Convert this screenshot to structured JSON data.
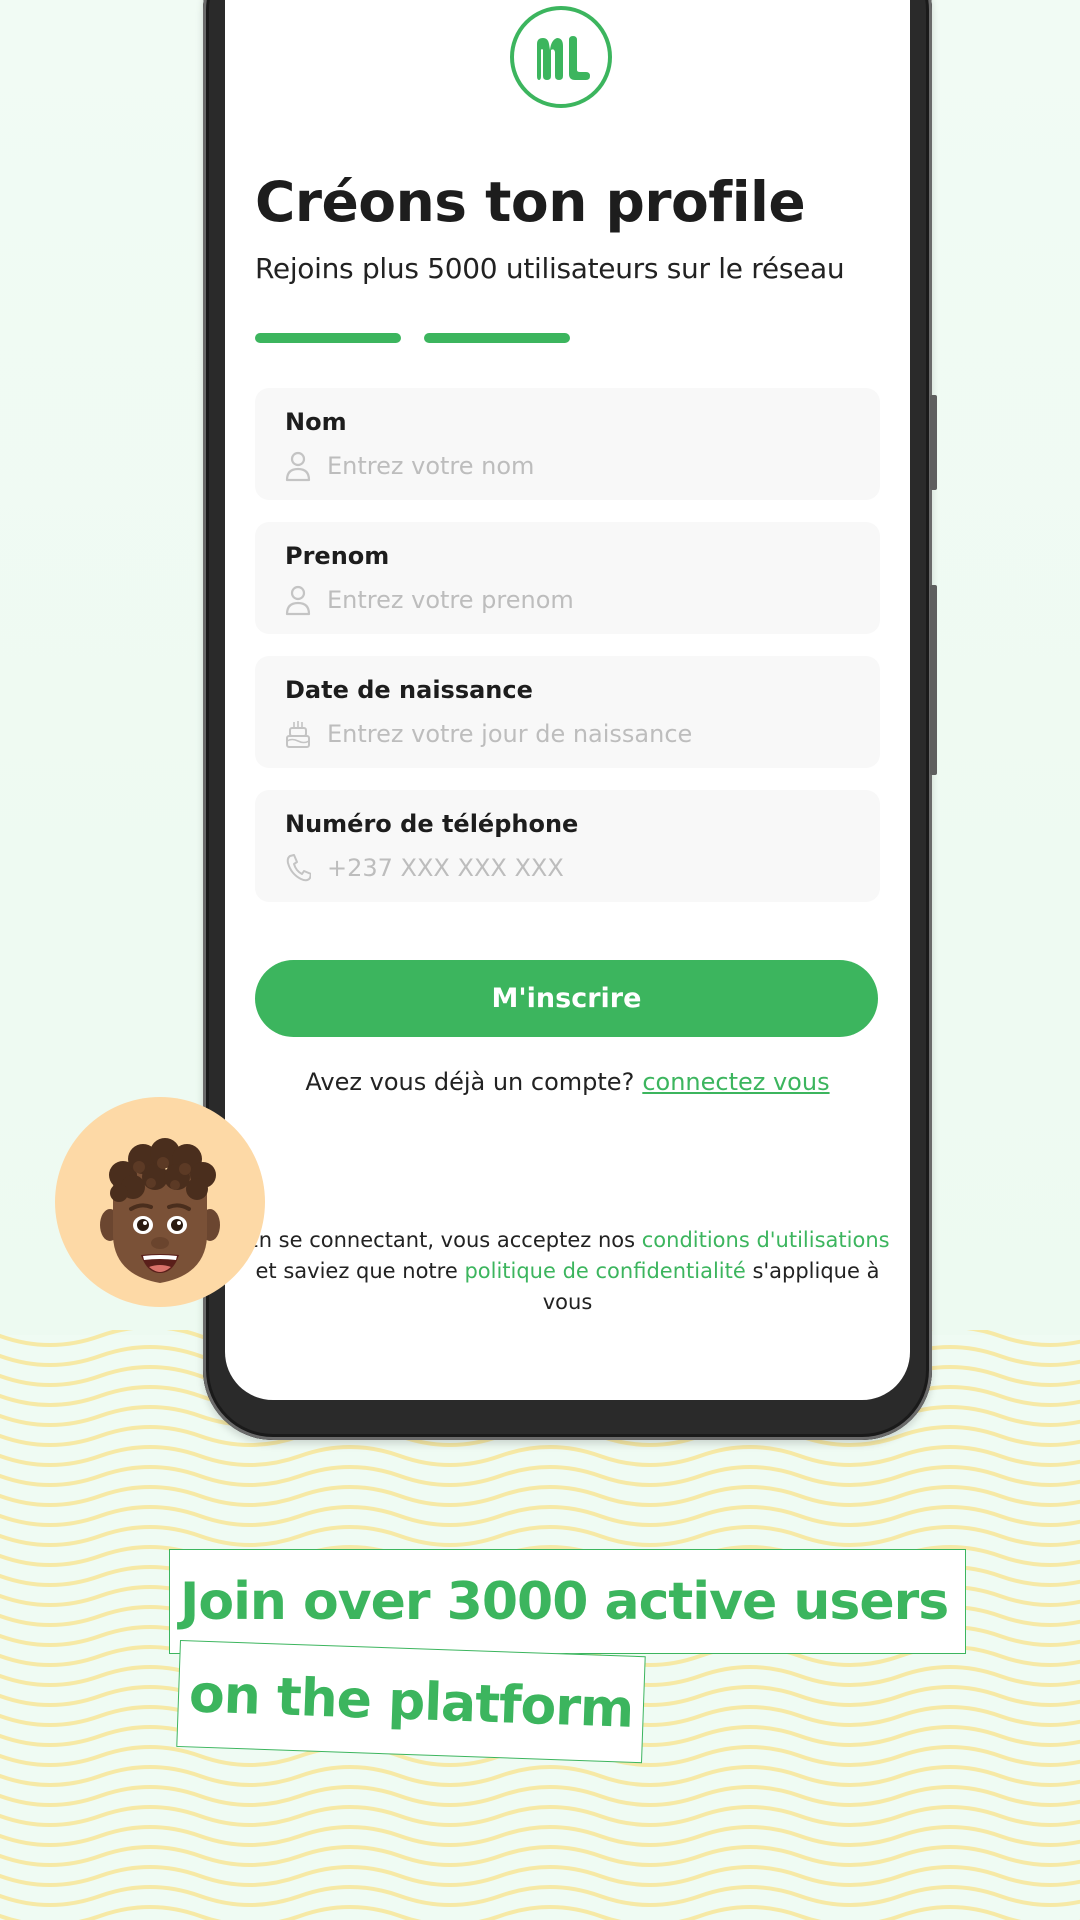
{
  "app": {
    "logo_text": "ML",
    "brand_color": "#3cb55e"
  },
  "signup": {
    "title": "Créons ton profile",
    "subtitle": "Rejoins plus 5000 utilisateurs sur le réseau",
    "progress": {
      "completed_steps": 2,
      "total_steps": 2
    },
    "fields": [
      {
        "label": "Nom",
        "placeholder": "Entrez votre nom",
        "value": "",
        "icon": "user-icon"
      },
      {
        "label": "Prenom",
        "placeholder": "Entrez votre prenom",
        "value": "",
        "icon": "user-icon"
      },
      {
        "label": "Date de naissance",
        "placeholder": "Entrez votre jour de naissance",
        "value": "",
        "icon": "birthday-cake-icon"
      },
      {
        "label": "Numéro de téléphone",
        "placeholder": "+237 XXX XXX XXX",
        "value": "",
        "icon": "phone-icon"
      }
    ],
    "submit_label": "M'inscrire",
    "login_prompt": "Avez vous déjà un compte?",
    "login_link": "connectez vous",
    "legal": {
      "part1": "En se connectant, vous acceptez nos ",
      "terms_link": "conditions d'utilisations",
      "part2": " et saviez que notre ",
      "privacy_link": "politique de confidentialité",
      "part3": " s'applique à vous"
    }
  },
  "promo": {
    "line1": "Join over 3000 active users",
    "line2": "on the platform"
  }
}
